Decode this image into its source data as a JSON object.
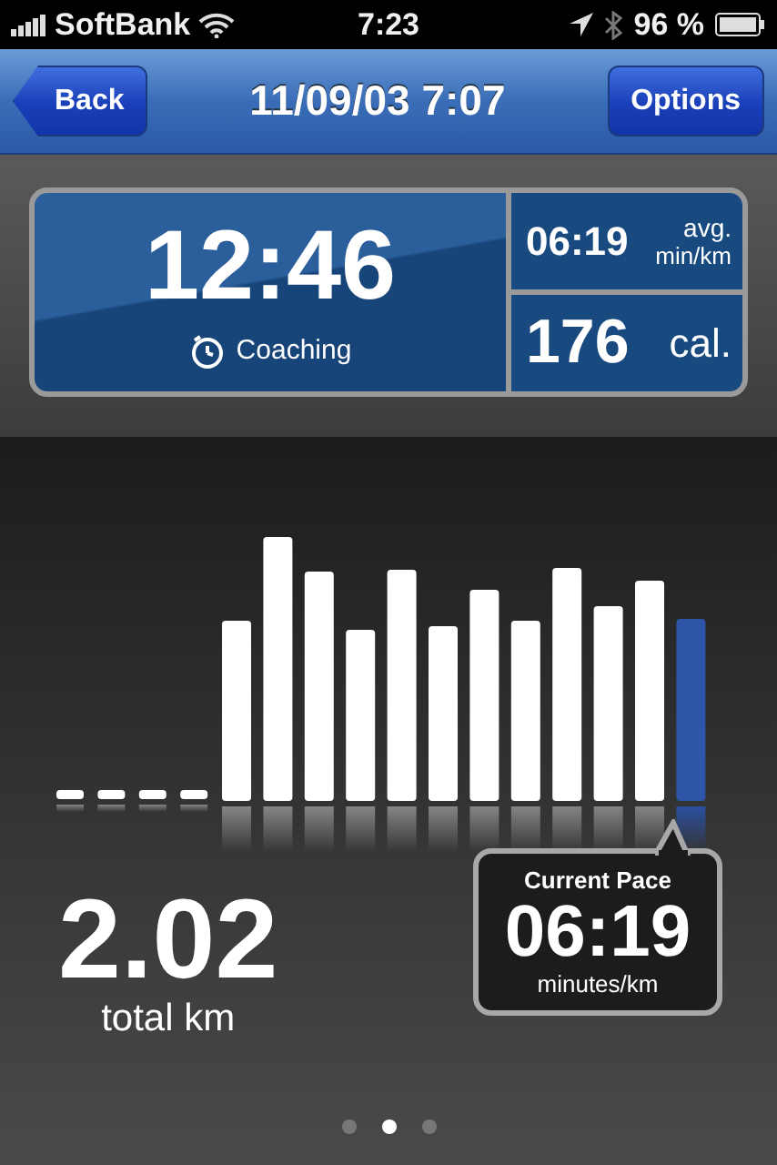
{
  "status_bar": {
    "carrier": "SoftBank",
    "time": "7:23",
    "battery": "96 %"
  },
  "nav_bar": {
    "back": "Back",
    "title": "11/09/03 7:07",
    "options": "Options"
  },
  "summary": {
    "duration": "12:46",
    "mode": "Coaching",
    "avg_pace": "06:19",
    "avg_pace_unit_1": "avg.",
    "avg_pace_unit_2": "min/km",
    "calories": "176",
    "calories_unit": "cal."
  },
  "distance": {
    "value": "2.02",
    "unit": "total km"
  },
  "current_pace": {
    "title": "Current Pace",
    "value": "06:19",
    "unit": "minutes/km"
  },
  "page_dots": [
    {
      "selected": false
    },
    {
      "selected": true
    },
    {
      "selected": false
    }
  ]
}
